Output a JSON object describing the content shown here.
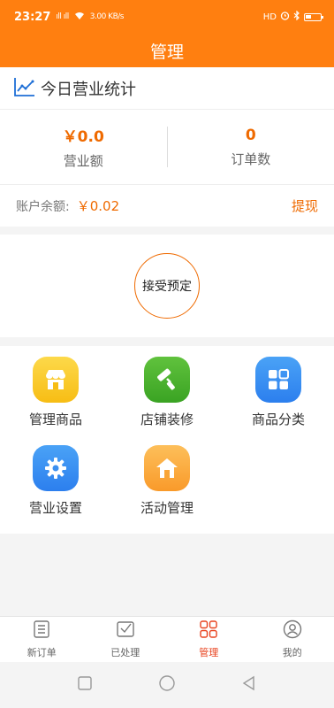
{
  "status_bar": {
    "time": "23:27",
    "signal_text": "ıll ıll",
    "net_speed": "3.00 KB/s",
    "right_text": "HD"
  },
  "header": {
    "title": "管理"
  },
  "stats": {
    "title": "今日营业统计",
    "revenue_value": "￥0.0",
    "revenue_label": "营业额",
    "orders_value": "0",
    "orders_label": "订单数"
  },
  "balance": {
    "label": "账户余额:",
    "value": "￥0.02",
    "withdraw_label": "提现"
  },
  "reserve": {
    "button_label": "接受预定"
  },
  "grid": {
    "items": [
      {
        "label": "管理商品",
        "icon": "store-icon"
      },
      {
        "label": "店铺装修",
        "icon": "paint-roller-icon"
      },
      {
        "label": "商品分类",
        "icon": "category-grid-icon"
      },
      {
        "label": "营业设置",
        "icon": "gear-icon"
      },
      {
        "label": "活动管理",
        "icon": "home-icon"
      }
    ]
  },
  "bottom_nav": {
    "items": [
      {
        "label": "新订单",
        "icon": "order-list-icon"
      },
      {
        "label": "已处理",
        "icon": "processed-icon"
      },
      {
        "label": "管理",
        "icon": "manage-grid-icon",
        "active": true
      },
      {
        "label": "我的",
        "icon": "profile-icon"
      }
    ]
  },
  "colors": {
    "brand": "#ff7f10",
    "accent_text": "#ef6a00",
    "active_nav": "#e8421e"
  }
}
